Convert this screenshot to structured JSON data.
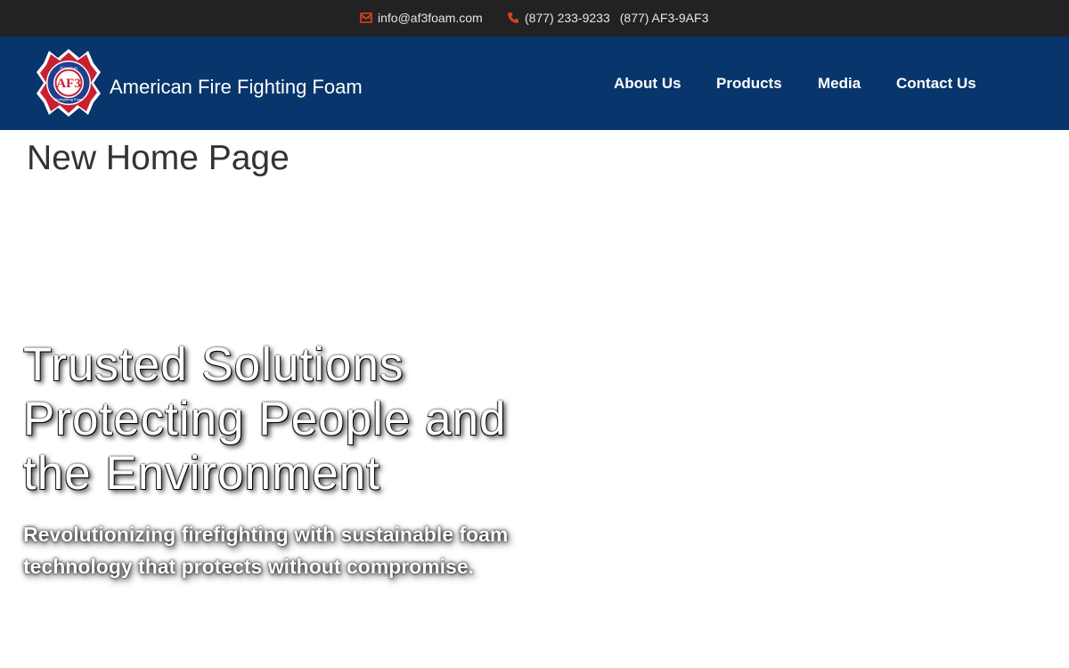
{
  "topbar": {
    "email": "info@af3foam.com",
    "phone_1": "(877) 233-9233",
    "phone_2": "(877) AF3-9AF3",
    "email_icon": "envelope-icon",
    "phone_icon": "phone-icon",
    "icon_color": "#d9421b"
  },
  "header": {
    "brand_name": "American Fire Fighting Foam",
    "logo": {
      "icon": "maltese-cross-logo",
      "monogram": "AF3",
      "ring_text_top": "American",
      "ring_text_bottom": "Firefighting Foam"
    },
    "nav": {
      "about": "About Us",
      "products": "Products",
      "media": "Media",
      "contact": "Contact Us"
    },
    "background": "#08356b"
  },
  "main": {
    "page_title": "New Home Page",
    "hero_heading": "Trusted Solutions Protecting People and the Environment",
    "hero_subheading": "Revolutionizing firefighting with sustainable foam technology that protects without compromise."
  }
}
